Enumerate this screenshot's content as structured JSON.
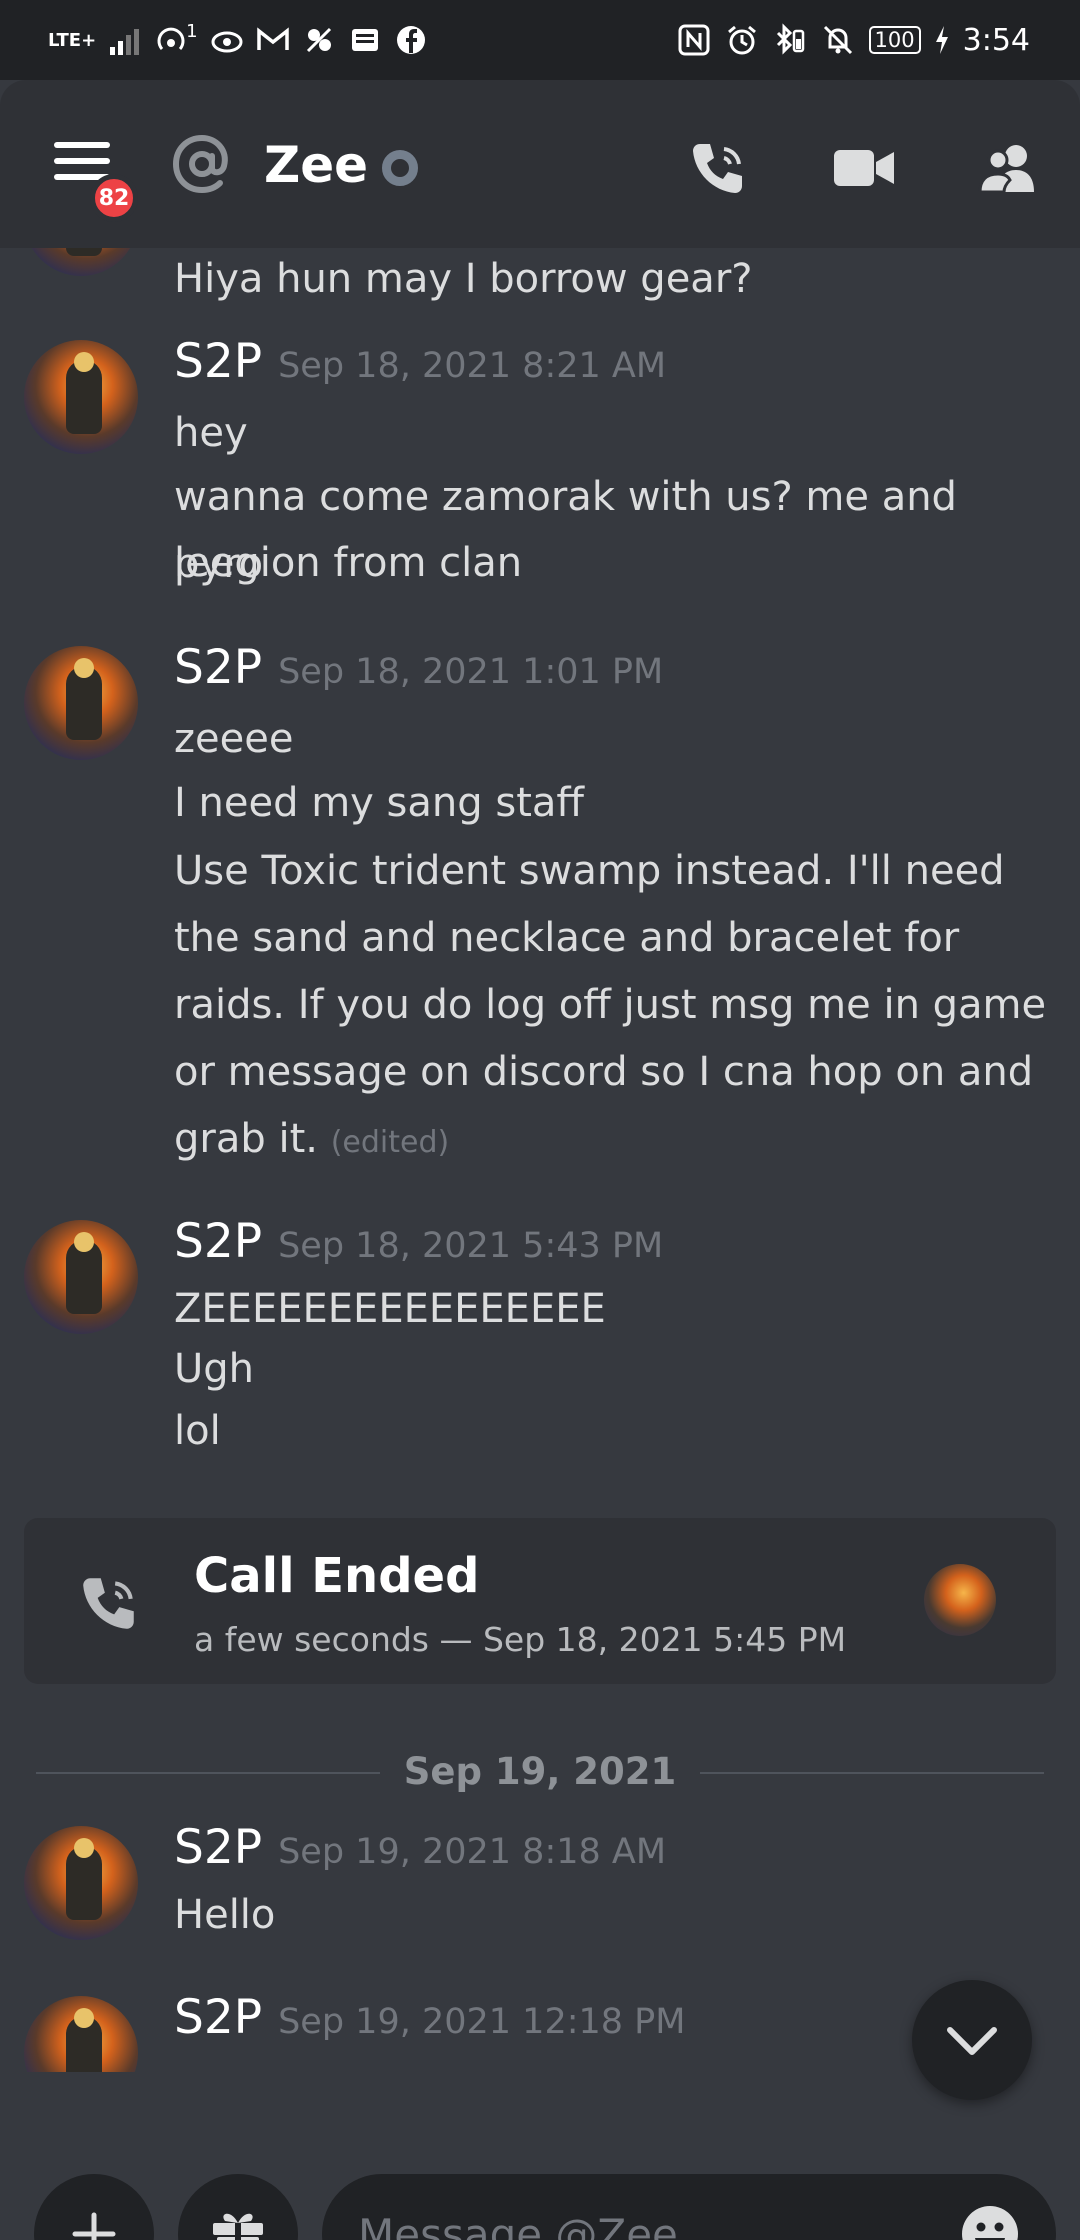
{
  "status_bar": {
    "network": "LTE+",
    "hotspot_count": "1",
    "battery": "100",
    "time": "3:54"
  },
  "header": {
    "badge_count": "82",
    "title": "Zee"
  },
  "messages": [
    {
      "continued": true,
      "lines": [
        "Hiya hun may I borrow gear?"
      ]
    },
    {
      "author": "S2P",
      "timestamp": "Sep 18, 2021 8:21 AM",
      "lines": [
        "hey",
        "wanna come zamorak with us? me and pyro",
        "leegion from clan"
      ]
    },
    {
      "author": "S2P",
      "timestamp": "Sep 18, 2021 1:01 PM",
      "lines": [
        "zeeee",
        "I need my sang staff",
        "Use Toxic trident swamp instead. I'll need",
        "the sand and necklace and bracelet for",
        "raids. If you do log off just msg me in game",
        "or message on discord so I cna hop on and",
        "grab it."
      ],
      "edited": "(edited)"
    },
    {
      "author": "S2P",
      "timestamp": "Sep 18, 2021 5:43 PM",
      "lines": [
        "ZEEEEEEEEEEEEEEEE",
        "Ugh",
        "lol"
      ]
    },
    {
      "author": "S2P",
      "timestamp": "Sep 19, 2021 8:18 AM",
      "lines": [
        "Hello"
      ]
    },
    {
      "author": "S2P",
      "timestamp": "Sep 19, 2021 12:18 PM",
      "lines": []
    }
  ],
  "call": {
    "title": "Call Ended",
    "detail": "a few seconds — Sep 18, 2021 5:45 PM"
  },
  "date_divider": "Sep 19, 2021",
  "composer": {
    "placeholder": "Message @Zee"
  },
  "colors": {
    "background": "#36393f",
    "header": "#2f3136",
    "input": "#202225",
    "badge": "#ed4245",
    "muted_text": "#72767d"
  },
  "icons": [
    "menu-icon",
    "at-icon",
    "offline-status-icon",
    "phone-call-icon",
    "video-call-icon",
    "members-icon",
    "plus-icon",
    "gift-icon",
    "emoji-icon",
    "chevron-down-icon"
  ]
}
